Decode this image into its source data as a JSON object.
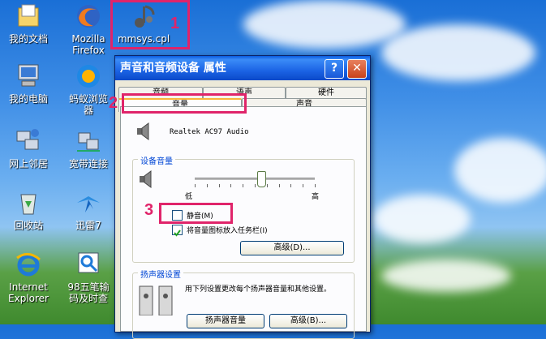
{
  "desktop": {
    "icons": [
      {
        "label": "我的文档",
        "icon": "my-documents-icon"
      },
      {
        "label": "Mozilla\nFirefox",
        "icon": "firefox-icon"
      },
      {
        "label": "mmsys.cpl",
        "icon": "mmsys-cpl-icon"
      },
      {
        "label": "我的电脑",
        "icon": "my-computer-icon"
      },
      {
        "label": "蚂蚁浏览\n器",
        "icon": "ant-browser-icon"
      },
      {
        "label": "网上邻居",
        "icon": "network-places-icon"
      },
      {
        "label": "宽带连接",
        "icon": "broadband-connection-icon"
      },
      {
        "label": "回收站",
        "icon": "recycle-bin-icon"
      },
      {
        "label": "迅雷7",
        "icon": "thunder-icon"
      },
      {
        "label": "Internet\nExplorer",
        "icon": "internet-explorer-icon"
      },
      {
        "label": "98五笔输\n码及时查",
        "icon": "wubi-lookup-icon"
      }
    ]
  },
  "annotations": [
    "1",
    "2",
    "3"
  ],
  "dialog": {
    "title": "声音和音频设备 属性",
    "help_label": "?",
    "close_label": "✕",
    "tabs_back": [
      "音频",
      "语声",
      "硬件"
    ],
    "tabs_front": [
      "音量",
      "声音"
    ],
    "device_name": "Realtek AC97 Audio",
    "device_volume": {
      "title": "设备音量",
      "low_label": "低",
      "high_label": "高",
      "level": 0.55
    },
    "mute_label": "静音(M)",
    "mute_checked": false,
    "tray_label": "将音量图标放入任务栏(I)",
    "tray_checked": true,
    "advanced_button": "高级(D)...",
    "speaker": {
      "title": "扬声器设置",
      "description": "用下列设置更改每个扬声器音量和其他设置。",
      "volume_button": "扬声器音量",
      "advanced_button": "高级(B)..."
    }
  },
  "colors": {
    "annotation": "#e0246a",
    "titlebar": "#1c64e5"
  }
}
